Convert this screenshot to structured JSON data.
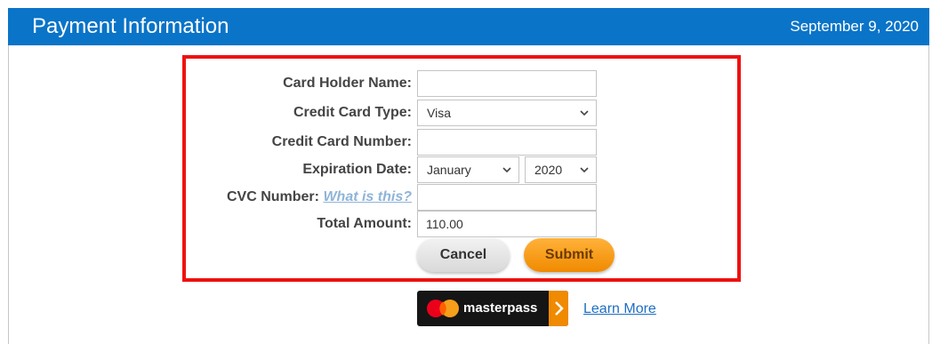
{
  "header": {
    "title": "Payment Information",
    "date": "September 9, 2020"
  },
  "form": {
    "card_holder_label": "Card Holder Name:",
    "card_holder_value": "",
    "card_type_label": "Credit Card Type:",
    "card_type_value": "Visa",
    "card_number_label": "Credit Card Number:",
    "card_number_value": "",
    "expiration_label": "Expiration Date:",
    "expiration_month": "January",
    "expiration_year": "2020",
    "cvc_label": "CVC Number:",
    "cvc_help": "What is this?",
    "cvc_value": "",
    "total_label": "Total Amount:",
    "total_value": "110.00"
  },
  "buttons": {
    "cancel": "Cancel",
    "submit": "Submit"
  },
  "masterpass": {
    "label": "masterpass",
    "learn_more": "Learn More"
  },
  "colors": {
    "header_bg": "#0a74c8",
    "highlight_border": "#ee1111",
    "submit_button": "#f5a020",
    "link": "#1e6fc2"
  }
}
